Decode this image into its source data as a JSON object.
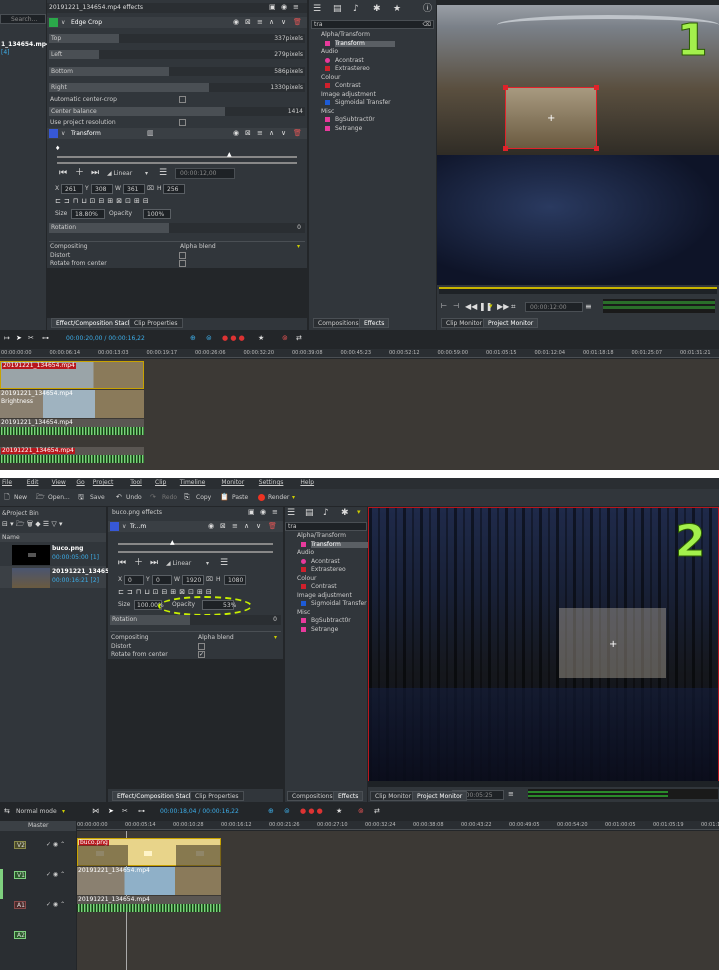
{
  "s1": {
    "bin_search": "Search...",
    "bin_clip": "1_134654.mp4",
    "bin_clip_sub": "[4]",
    "effects_title": "20191221_134654.mp4 effects",
    "edge_crop": "Edge Crop",
    "ec_rows": [
      {
        "label": "Top",
        "value": "337pixels"
      },
      {
        "label": "Left",
        "value": "279pixels"
      },
      {
        "label": "Bottom",
        "value": "586pixels"
      },
      {
        "label": "Right",
        "value": "1330pixels"
      }
    ],
    "auto_center_crop": "Automatic center-crop",
    "center_balance": "Center balance",
    "center_balance_val": "1414",
    "use_project_res": "Use project resolution",
    "transform": "Transform",
    "interp": "Linear",
    "timecode": "00:00:12,00",
    "x_val": "261",
    "y_val": "308",
    "w_val": "361",
    "h_val": "256",
    "size_label": "Size",
    "size_val": "18.80%",
    "opacity_label": "Opacity",
    "opacity_val": "100%",
    "rotation_label": "Rotation",
    "rotation_val": "0",
    "compositing": "Compositing",
    "alpha_blend": "Alpha blend",
    "distort": "Distort",
    "rotate_from_center": "Rotate from center",
    "tab_effect_stack": "Effect/Composition Stack",
    "tab_clip_props": "Clip Properties",
    "search_text": "tra",
    "effects_tree": [
      {
        "t": "Alpha/Transform",
        "k": "cat"
      },
      {
        "t": "Transform",
        "k": "sel"
      },
      {
        "t": "Audio",
        "k": "cat"
      },
      {
        "t": "Acontrast",
        "k": "item-pink"
      },
      {
        "t": "Extrastereo",
        "k": "item-red"
      },
      {
        "t": "Colour",
        "k": "cat"
      },
      {
        "t": "Contrast",
        "k": "item-red"
      },
      {
        "t": "Image adjustment",
        "k": "cat"
      },
      {
        "t": "Sigmoidal Transfer",
        "k": "item-blue"
      },
      {
        "t": "Misc",
        "k": "cat"
      },
      {
        "t": "BgSubtract0r",
        "k": "item-pink"
      },
      {
        "t": "Setrange",
        "k": "item-pink"
      }
    ],
    "tab_compositions": "Compositions",
    "tab_effects": "Effects",
    "monitor_timecode": "00:00:12:00",
    "tab_clip_monitor": "Clip Monitor",
    "tab_project_monitor": "Project Monitor",
    "badge": "1",
    "ruler": [
      "00:00:00:00",
      "00:00:06:14",
      "00:00:13:03",
      "00:00:19:17",
      "00:00:26:06",
      "00:00:32:20",
      "00:00:39:08",
      "00:00:45:23",
      "00:00:52:12",
      "00:00:59:00",
      "00:01:05:15",
      "00:01:12:04",
      "00:01:18:18",
      "00:01:25:07",
      "00:01:31:21"
    ],
    "tl_timecode": "00:00:20,00 / 00:00:16,22",
    "clip_a": "20191221_134654.mp4",
    "clip_b": "20191221_134654.mp4",
    "clip_b2": "Brightness",
    "clip_c": "20191221_134654.mp4",
    "clip_d": "20191221_134654.mp4"
  },
  "s2": {
    "menu": [
      "File",
      "Edit",
      "View",
      "Go",
      "Project",
      "Tool",
      "Clip",
      "Timeline",
      "Monitor",
      "Settings",
      "Help"
    ],
    "toolbar": [
      "New",
      "Open...",
      "Save",
      "Undo",
      "Redo",
      "Copy",
      "Paste",
      "Render"
    ],
    "bin_title": "&Project Bin",
    "bin_col": "Name",
    "bin_items": [
      {
        "name": "buco.png",
        "sub": "00:00:05:00 [1]"
      },
      {
        "name": "20191221_134654",
        "sub": "00:00:16:21 [2]"
      }
    ],
    "effects_title": "buco.png effects",
    "transform": "Tr...m",
    "interp": "Linear",
    "x_val": "0",
    "y_val": "0",
    "w_val": "1920",
    "h_val": "1080",
    "size_label": "Size",
    "size_val": "100.00%",
    "opacity_label": "Opacity",
    "opacity_val": "53%",
    "rotation_label": "Rotation",
    "rotation_val": "0",
    "compositing": "Compositing",
    "alpha_blend": "Alpha blend",
    "distort": "Distort",
    "rotate_from_center": "Rotate from center",
    "tab_effect_stack": "Effect/Composition Stack",
    "tab_clip_props": "Clip Properties",
    "search_text": "tra",
    "effects_tree": [
      {
        "t": "Alpha/Transform",
        "k": "cat"
      },
      {
        "t": "Transform",
        "k": "sel"
      },
      {
        "t": "Audio",
        "k": "cat"
      },
      {
        "t": "Acontrast",
        "k": "item-pink"
      },
      {
        "t": "Extrastereo",
        "k": "item-red"
      },
      {
        "t": "Colour",
        "k": "cat"
      },
      {
        "t": "Contrast",
        "k": "item-red"
      },
      {
        "t": "Image adjustment",
        "k": "cat"
      },
      {
        "t": "Sigmoidal Transfer",
        "k": "item-blue"
      },
      {
        "t": "Misc",
        "k": "cat"
      },
      {
        "t": "BgSubtract0r",
        "k": "item-pink"
      },
      {
        "t": "Setrange",
        "k": "item-pink"
      }
    ],
    "tab_compositions": "Compositions",
    "tab_effects": "Effects",
    "tab_clip_monitor": "Clip Monitor",
    "tab_project_monitor": "Project Monitor",
    "monitor_timecode": "00:00:05:25",
    "badge": "2",
    "mode": "Normal mode",
    "tl_timecode": "00:00:18,04 / 00:00:16,22",
    "master": "Master",
    "tracks": [
      "V2",
      "V1",
      "A1",
      "A2"
    ],
    "ruler": [
      "00:00:00:00",
      "00:00:05:14",
      "00:00:10:28",
      "00:00:16:12",
      "00:00:21:26",
      "00:00:27:10",
      "00:00:32:24",
      "00:00:38:08",
      "00:00:43:22",
      "00:00:49:05",
      "00:00:54:20",
      "00:01:00:05",
      "00:01:05:19",
      "00:01:1"
    ],
    "clip_png": "buco.png",
    "clip_v1": "20191221_134654.mp4",
    "clip_a1": "20191221_134654.mp4"
  },
  "colors": {
    "accent": "#3daee9",
    "badge": "#a3f04c",
    "highlight_circle": "#c8f000",
    "clip_yellow": "#e8d48a",
    "audio_green": "#7fd07f"
  }
}
